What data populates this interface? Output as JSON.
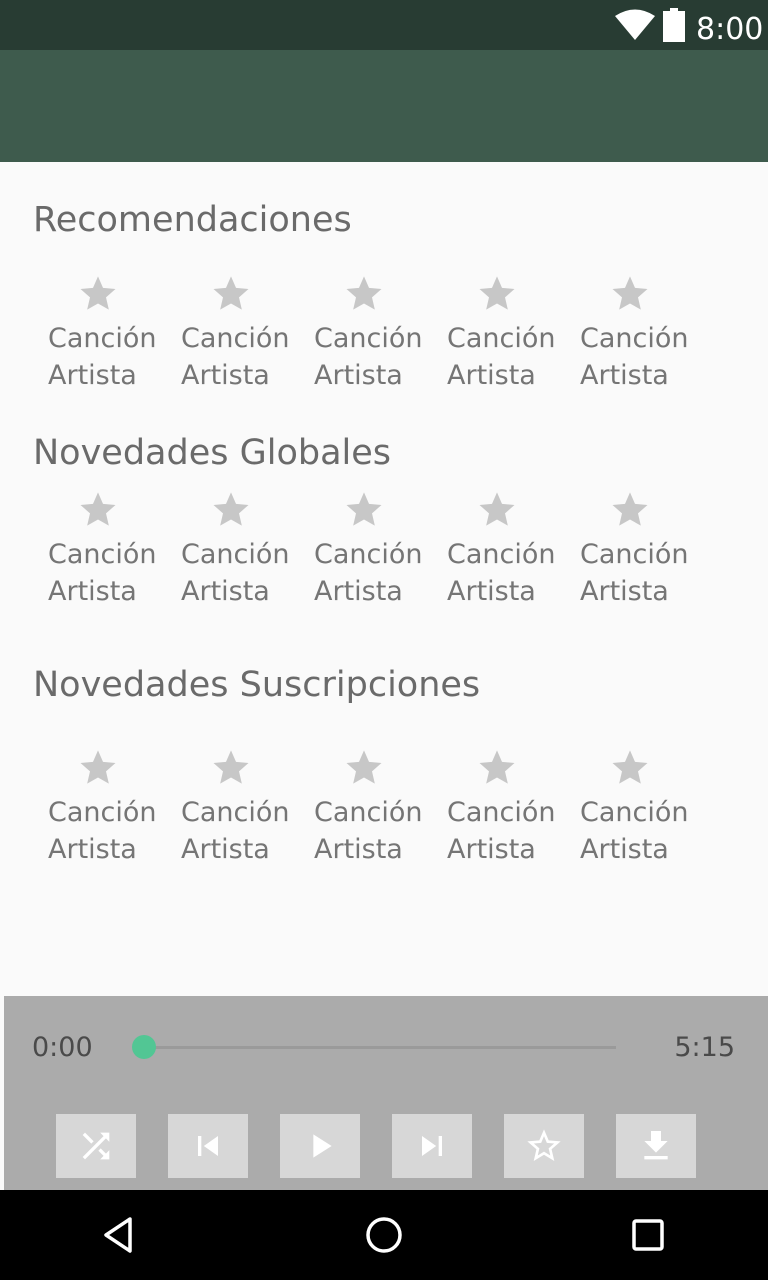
{
  "status_bar": {
    "time": "8:00"
  },
  "sections": [
    {
      "title": "Recomendaciones",
      "songs": [
        {
          "title": "Canción",
          "artist": "Artista"
        },
        {
          "title": "Canción",
          "artist": "Artista"
        },
        {
          "title": "Canción",
          "artist": "Artista"
        },
        {
          "title": "Canción",
          "artist": "Artista"
        },
        {
          "title": "Canción",
          "artist": "Artista"
        }
      ]
    },
    {
      "title": "Novedades Globales",
      "songs": [
        {
          "title": "Canción",
          "artist": "Artista"
        },
        {
          "title": "Canción",
          "artist": "Artista"
        },
        {
          "title": "Canción",
          "artist": "Artista"
        },
        {
          "title": "Canción",
          "artist": "Artista"
        },
        {
          "title": "Canción",
          "artist": "Artista"
        }
      ]
    },
    {
      "title": "Novedades Suscripciones",
      "songs": [
        {
          "title": "Canción",
          "artist": "Artista"
        },
        {
          "title": "Canción",
          "artist": "Artista"
        },
        {
          "title": "Canción",
          "artist": "Artista"
        },
        {
          "title": "Canción",
          "artist": "Artista"
        },
        {
          "title": "Canción",
          "artist": "Artista"
        }
      ]
    }
  ],
  "player": {
    "current_time": "0:00",
    "duration": "5:15",
    "progress_fraction": 0.0,
    "controls": [
      "shuffle-icon",
      "skip-previous-icon",
      "play-icon",
      "skip-next-icon",
      "star-outline-icon",
      "download-icon"
    ]
  },
  "colors": {
    "status_bar": "#283c33",
    "app_bar": "#3e5b4d",
    "accent": "#52c694",
    "player_bg": "#ababab"
  },
  "nav_bar": {
    "icons": [
      "back-icon",
      "home-icon",
      "recents-icon"
    ]
  }
}
